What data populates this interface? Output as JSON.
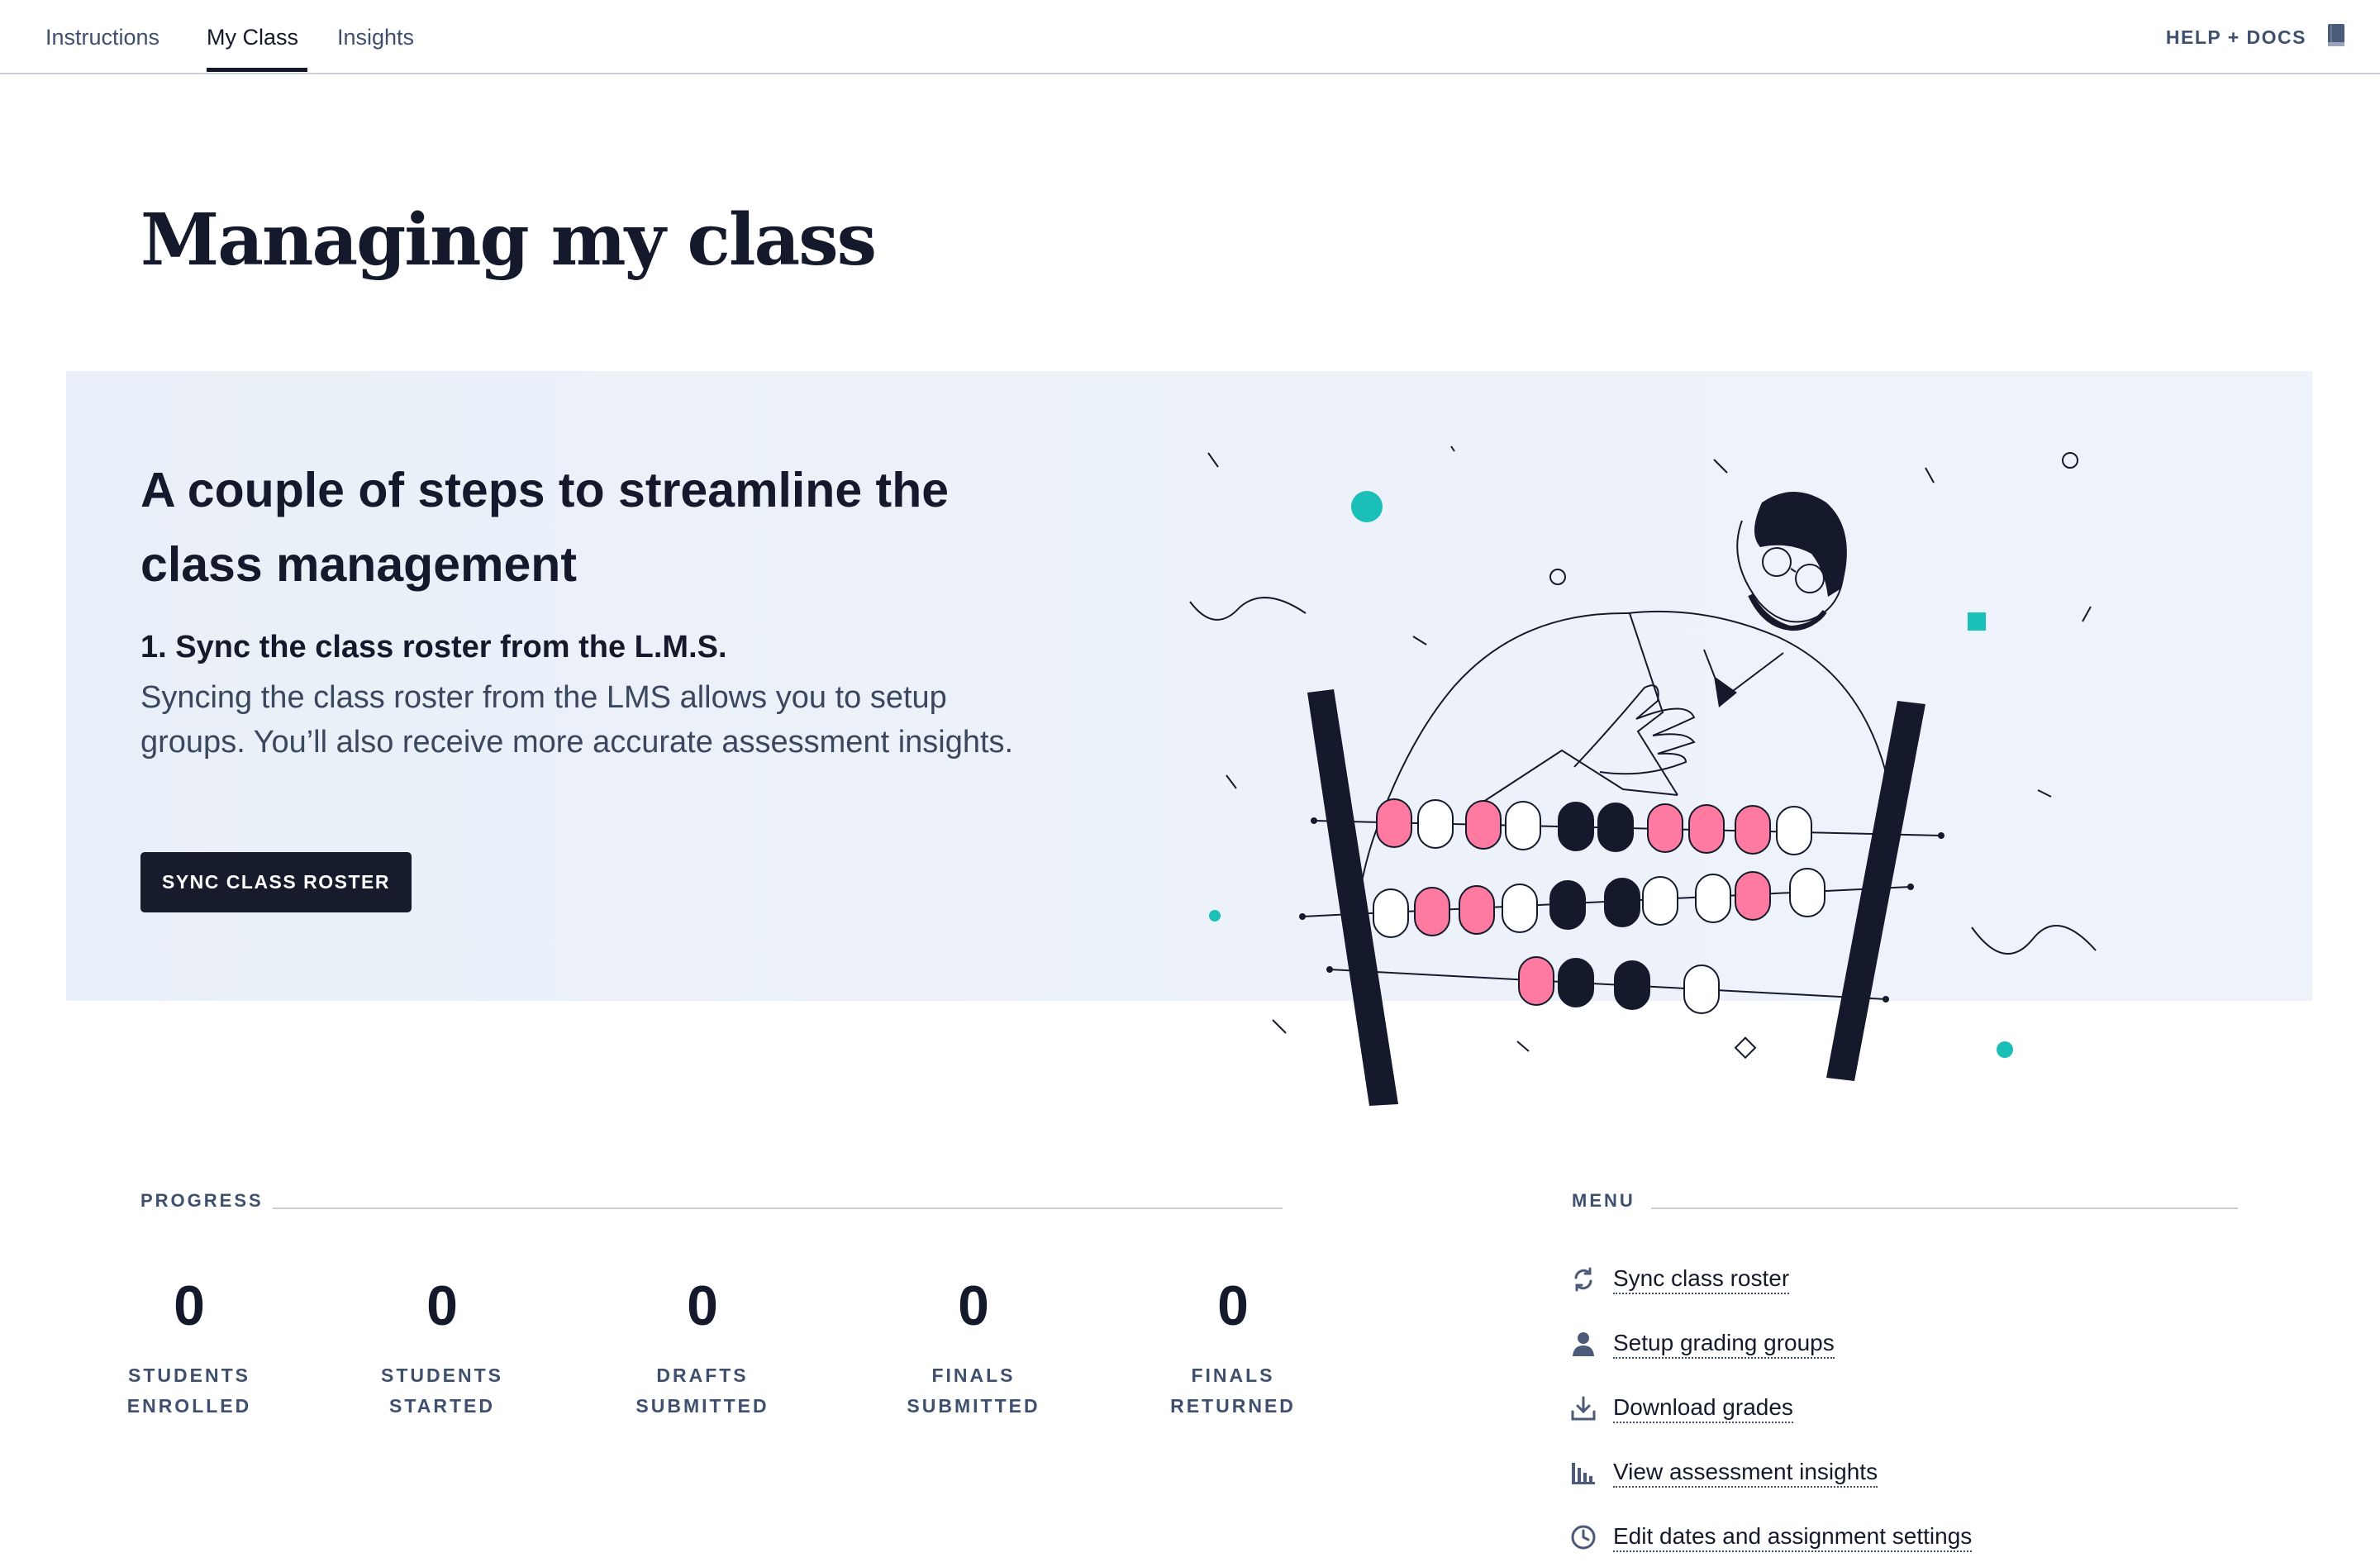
{
  "nav": {
    "tabs": [
      {
        "label": "Instructions"
      },
      {
        "label": "My Class"
      },
      {
        "label": "Insights"
      }
    ],
    "active_tab": "My Class",
    "help_label": "HELP + DOCS"
  },
  "page": {
    "title": "Managing my class"
  },
  "hero": {
    "title": "A couple of steps to streamline the class management",
    "step_title": "1. Sync the class roster from the L.M.S.",
    "step_description": "Syncing the class roster from the LMS allows you to setup groups. You’ll also receive more accurate assessment insights.",
    "button_label": "SYNC CLASS ROSTER"
  },
  "progress": {
    "label": "PROGRESS",
    "stats": [
      {
        "value": "0",
        "line1": "STUDENTS",
        "line2": "ENROLLED"
      },
      {
        "value": "0",
        "line1": "STUDENTS",
        "line2": "STARTED"
      },
      {
        "value": "0",
        "line1": "DRAFTS",
        "line2": "SUBMITTED"
      },
      {
        "value": "0",
        "line1": "FINALS",
        "line2": "SUBMITTED"
      },
      {
        "value": "0",
        "line1": "FINALS",
        "line2": "RETURNED"
      }
    ]
  },
  "menu": {
    "label": "MENU",
    "items": [
      {
        "label": "Sync class roster",
        "icon": "sync-icon"
      },
      {
        "label": "Setup grading groups",
        "icon": "person-icon"
      },
      {
        "label": "Download grades",
        "icon": "download-icon"
      },
      {
        "label": "View assessment insights",
        "icon": "bar-chart-icon"
      },
      {
        "label": "Edit dates and assignment settings",
        "icon": "clock-icon"
      }
    ]
  },
  "colors": {
    "dark": "#141a2b",
    "muted": "#3f4f6e",
    "hero_bg": "#ebf1f9",
    "bead_pink": "#ff7aa0",
    "accent_teal": "#1abfb8"
  }
}
